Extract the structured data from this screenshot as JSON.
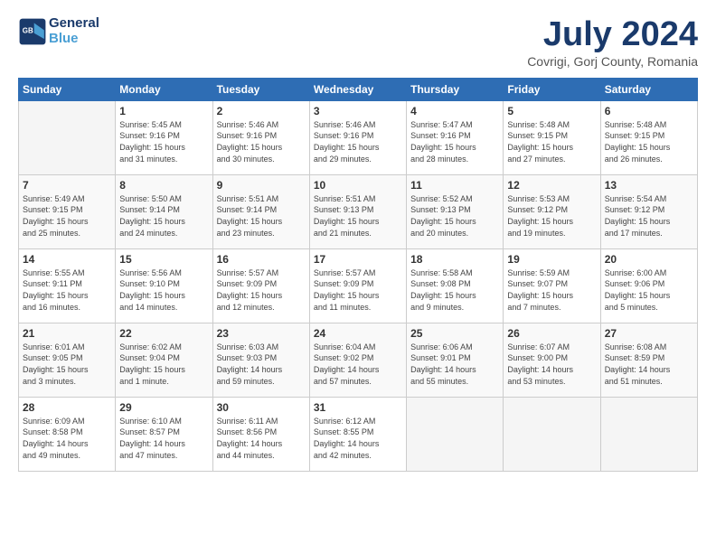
{
  "header": {
    "logo_line1": "General",
    "logo_line2": "Blue",
    "month": "July 2024",
    "location": "Covrigi, Gorj County, Romania"
  },
  "weekdays": [
    "Sunday",
    "Monday",
    "Tuesday",
    "Wednesday",
    "Thursday",
    "Friday",
    "Saturday"
  ],
  "weeks": [
    [
      {
        "day": "",
        "info": ""
      },
      {
        "day": "1",
        "info": "Sunrise: 5:45 AM\nSunset: 9:16 PM\nDaylight: 15 hours\nand 31 minutes."
      },
      {
        "day": "2",
        "info": "Sunrise: 5:46 AM\nSunset: 9:16 PM\nDaylight: 15 hours\nand 30 minutes."
      },
      {
        "day": "3",
        "info": "Sunrise: 5:46 AM\nSunset: 9:16 PM\nDaylight: 15 hours\nand 29 minutes."
      },
      {
        "day": "4",
        "info": "Sunrise: 5:47 AM\nSunset: 9:16 PM\nDaylight: 15 hours\nand 28 minutes."
      },
      {
        "day": "5",
        "info": "Sunrise: 5:48 AM\nSunset: 9:15 PM\nDaylight: 15 hours\nand 27 minutes."
      },
      {
        "day": "6",
        "info": "Sunrise: 5:48 AM\nSunset: 9:15 PM\nDaylight: 15 hours\nand 26 minutes."
      }
    ],
    [
      {
        "day": "7",
        "info": "Sunrise: 5:49 AM\nSunset: 9:15 PM\nDaylight: 15 hours\nand 25 minutes."
      },
      {
        "day": "8",
        "info": "Sunrise: 5:50 AM\nSunset: 9:14 PM\nDaylight: 15 hours\nand 24 minutes."
      },
      {
        "day": "9",
        "info": "Sunrise: 5:51 AM\nSunset: 9:14 PM\nDaylight: 15 hours\nand 23 minutes."
      },
      {
        "day": "10",
        "info": "Sunrise: 5:51 AM\nSunset: 9:13 PM\nDaylight: 15 hours\nand 21 minutes."
      },
      {
        "day": "11",
        "info": "Sunrise: 5:52 AM\nSunset: 9:13 PM\nDaylight: 15 hours\nand 20 minutes."
      },
      {
        "day": "12",
        "info": "Sunrise: 5:53 AM\nSunset: 9:12 PM\nDaylight: 15 hours\nand 19 minutes."
      },
      {
        "day": "13",
        "info": "Sunrise: 5:54 AM\nSunset: 9:12 PM\nDaylight: 15 hours\nand 17 minutes."
      }
    ],
    [
      {
        "day": "14",
        "info": "Sunrise: 5:55 AM\nSunset: 9:11 PM\nDaylight: 15 hours\nand 16 minutes."
      },
      {
        "day": "15",
        "info": "Sunrise: 5:56 AM\nSunset: 9:10 PM\nDaylight: 15 hours\nand 14 minutes."
      },
      {
        "day": "16",
        "info": "Sunrise: 5:57 AM\nSunset: 9:09 PM\nDaylight: 15 hours\nand 12 minutes."
      },
      {
        "day": "17",
        "info": "Sunrise: 5:57 AM\nSunset: 9:09 PM\nDaylight: 15 hours\nand 11 minutes."
      },
      {
        "day": "18",
        "info": "Sunrise: 5:58 AM\nSunset: 9:08 PM\nDaylight: 15 hours\nand 9 minutes."
      },
      {
        "day": "19",
        "info": "Sunrise: 5:59 AM\nSunset: 9:07 PM\nDaylight: 15 hours\nand 7 minutes."
      },
      {
        "day": "20",
        "info": "Sunrise: 6:00 AM\nSunset: 9:06 PM\nDaylight: 15 hours\nand 5 minutes."
      }
    ],
    [
      {
        "day": "21",
        "info": "Sunrise: 6:01 AM\nSunset: 9:05 PM\nDaylight: 15 hours\nand 3 minutes."
      },
      {
        "day": "22",
        "info": "Sunrise: 6:02 AM\nSunset: 9:04 PM\nDaylight: 15 hours\nand 1 minute."
      },
      {
        "day": "23",
        "info": "Sunrise: 6:03 AM\nSunset: 9:03 PM\nDaylight: 14 hours\nand 59 minutes."
      },
      {
        "day": "24",
        "info": "Sunrise: 6:04 AM\nSunset: 9:02 PM\nDaylight: 14 hours\nand 57 minutes."
      },
      {
        "day": "25",
        "info": "Sunrise: 6:06 AM\nSunset: 9:01 PM\nDaylight: 14 hours\nand 55 minutes."
      },
      {
        "day": "26",
        "info": "Sunrise: 6:07 AM\nSunset: 9:00 PM\nDaylight: 14 hours\nand 53 minutes."
      },
      {
        "day": "27",
        "info": "Sunrise: 6:08 AM\nSunset: 8:59 PM\nDaylight: 14 hours\nand 51 minutes."
      }
    ],
    [
      {
        "day": "28",
        "info": "Sunrise: 6:09 AM\nSunset: 8:58 PM\nDaylight: 14 hours\nand 49 minutes."
      },
      {
        "day": "29",
        "info": "Sunrise: 6:10 AM\nSunset: 8:57 PM\nDaylight: 14 hours\nand 47 minutes."
      },
      {
        "day": "30",
        "info": "Sunrise: 6:11 AM\nSunset: 8:56 PM\nDaylight: 14 hours\nand 44 minutes."
      },
      {
        "day": "31",
        "info": "Sunrise: 6:12 AM\nSunset: 8:55 PM\nDaylight: 14 hours\nand 42 minutes."
      },
      {
        "day": "",
        "info": ""
      },
      {
        "day": "",
        "info": ""
      },
      {
        "day": "",
        "info": ""
      }
    ]
  ]
}
